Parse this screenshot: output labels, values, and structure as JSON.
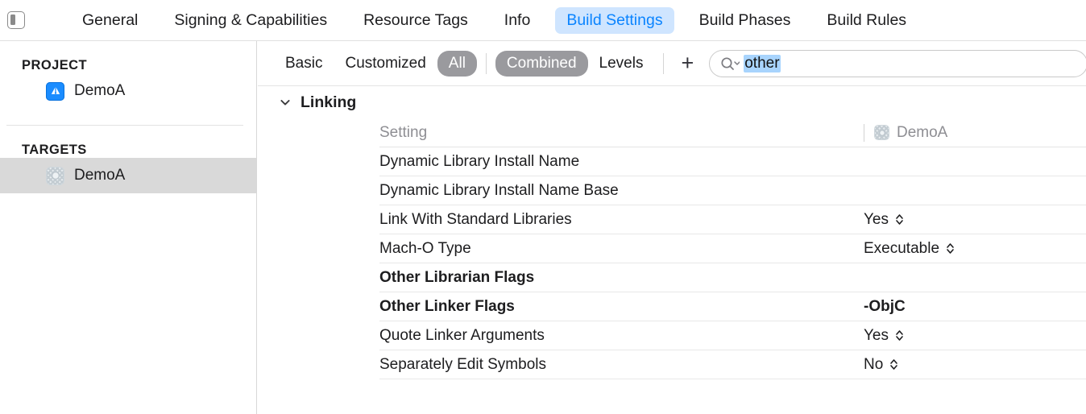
{
  "window": {
    "sidebar_toggle_icon": "sidebar-toggle-icon"
  },
  "tabs": [
    {
      "label": "General",
      "active": false
    },
    {
      "label": "Signing & Capabilities",
      "active": false
    },
    {
      "label": "Resource Tags",
      "active": false
    },
    {
      "label": "Info",
      "active": false
    },
    {
      "label": "Build Settings",
      "active": true
    },
    {
      "label": "Build Phases",
      "active": false
    },
    {
      "label": "Build Rules",
      "active": false
    }
  ],
  "accent_color": "#0a84ff",
  "active_tab_bg": "#cfe5ff",
  "selected_segment_bg": "#9a9a9e",
  "sidebar": {
    "project_heading": "PROJECT",
    "project_items": [
      {
        "label": "DemoA",
        "icon": "app-store-icon",
        "selected": false
      }
    ],
    "targets_heading": "TARGETS",
    "target_items": [
      {
        "label": "DemoA",
        "icon": "target-app-icon",
        "selected": true
      }
    ],
    "selected_row_bg": "#d9d9d9"
  },
  "filterbar": {
    "scope_buttons": [
      {
        "label": "Basic",
        "selected": false
      },
      {
        "label": "Customized",
        "selected": false
      },
      {
        "label": "All",
        "selected": true
      }
    ],
    "view_buttons": [
      {
        "label": "Combined",
        "selected": true
      },
      {
        "label": "Levels",
        "selected": false
      }
    ],
    "add_button_label": "+",
    "add_button_icon": "plus-icon",
    "search": {
      "icon": "search-icon",
      "dropdown_icon": "chevron-down-icon",
      "value": "other",
      "placeholder": "",
      "selection_highlight": "#a8d4fd"
    }
  },
  "settings": {
    "group": {
      "title": "Linking",
      "expanded": true,
      "disclosure_icon": "chevron-down-icon"
    },
    "columns": {
      "setting": "Setting",
      "target": "DemoA",
      "target_icon": "target-app-icon"
    },
    "rows": [
      {
        "name": "Dynamic Library Install Name",
        "value": "",
        "bold": false,
        "stepper": false
      },
      {
        "name": "Dynamic Library Install Name Base",
        "value": "",
        "bold": false,
        "stepper": false
      },
      {
        "name": "Link With Standard Libraries",
        "value": "Yes",
        "bold": false,
        "stepper": true
      },
      {
        "name": "Mach-O Type",
        "value": "Executable",
        "bold": false,
        "stepper": true
      },
      {
        "name": "Other Librarian Flags",
        "value": "",
        "bold": true,
        "stepper": false
      },
      {
        "name": "Other Linker Flags",
        "value": "-ObjC",
        "bold": true,
        "stepper": false
      },
      {
        "name": "Quote Linker Arguments",
        "value": "Yes",
        "bold": false,
        "stepper": true
      },
      {
        "name": "Separately Edit Symbols",
        "value": "No",
        "bold": false,
        "stepper": true
      }
    ]
  }
}
